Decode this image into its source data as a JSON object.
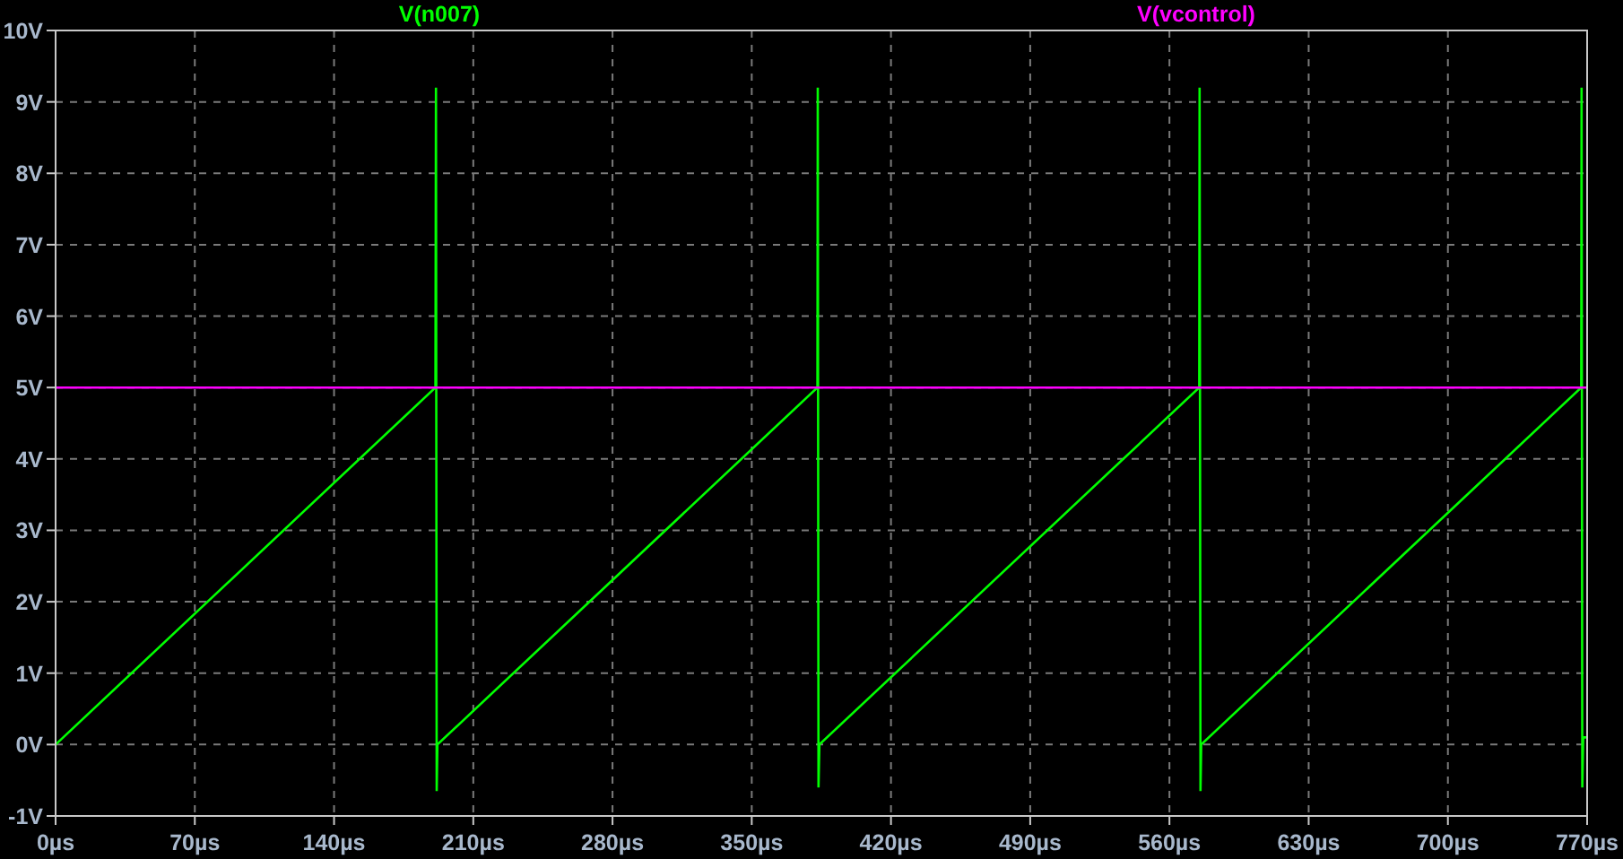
{
  "plot": {
    "chart_data": {
      "type": "line",
      "x": [
        0,
        191,
        191.2,
        191.6,
        192,
        383,
        383.2,
        383.6,
        384,
        575,
        575.2,
        575.6,
        576,
        767,
        767.2,
        767.6,
        768,
        770
      ],
      "series": [
        {
          "name": "V(n007)",
          "color": "#00ff00",
          "values": [
            0,
            5,
            9.2,
            -0.65,
            0,
            5,
            9.2,
            -0.6,
            0,
            5,
            9.2,
            -0.65,
            0,
            5,
            9.2,
            -0.6,
            0.1,
            0.1
          ]
        },
        {
          "name": "V(vcontrol)",
          "color": "#ff00ff",
          "values": [
            5,
            5,
            5,
            5,
            5,
            5,
            5,
            5,
            5,
            5,
            5,
            5,
            5,
            5,
            5,
            5,
            5,
            5
          ]
        }
      ],
      "grid": true,
      "xlim": [
        0,
        770
      ],
      "ylim": [
        -1,
        10
      ],
      "xticks": [
        {
          "value": 0,
          "label": "0µs"
        },
        {
          "value": 70,
          "label": "70µs"
        },
        {
          "value": 140,
          "label": "140µs"
        },
        {
          "value": 210,
          "label": "210µs"
        },
        {
          "value": 280,
          "label": "280µs"
        },
        {
          "value": 350,
          "label": "350µs"
        },
        {
          "value": 420,
          "label": "420µs"
        },
        {
          "value": 490,
          "label": "490µs"
        },
        {
          "value": 560,
          "label": "560µs"
        },
        {
          "value": 630,
          "label": "630µs"
        },
        {
          "value": 700,
          "label": "700µs"
        },
        {
          "value": 770,
          "label": "770µs"
        }
      ],
      "yticks": [
        {
          "value": -1,
          "label": "-1V"
        },
        {
          "value": 0,
          "label": "0V"
        },
        {
          "value": 1,
          "label": "1V"
        },
        {
          "value": 2,
          "label": "2V"
        },
        {
          "value": 3,
          "label": "3V"
        },
        {
          "value": 4,
          "label": "4V"
        },
        {
          "value": 5,
          "label": "5V"
        },
        {
          "value": 6,
          "label": "6V"
        },
        {
          "value": 7,
          "label": "7V"
        },
        {
          "value": 8,
          "label": "8V"
        },
        {
          "value": 9,
          "label": "9V"
        },
        {
          "value": 10,
          "label": "10V"
        }
      ]
    }
  }
}
